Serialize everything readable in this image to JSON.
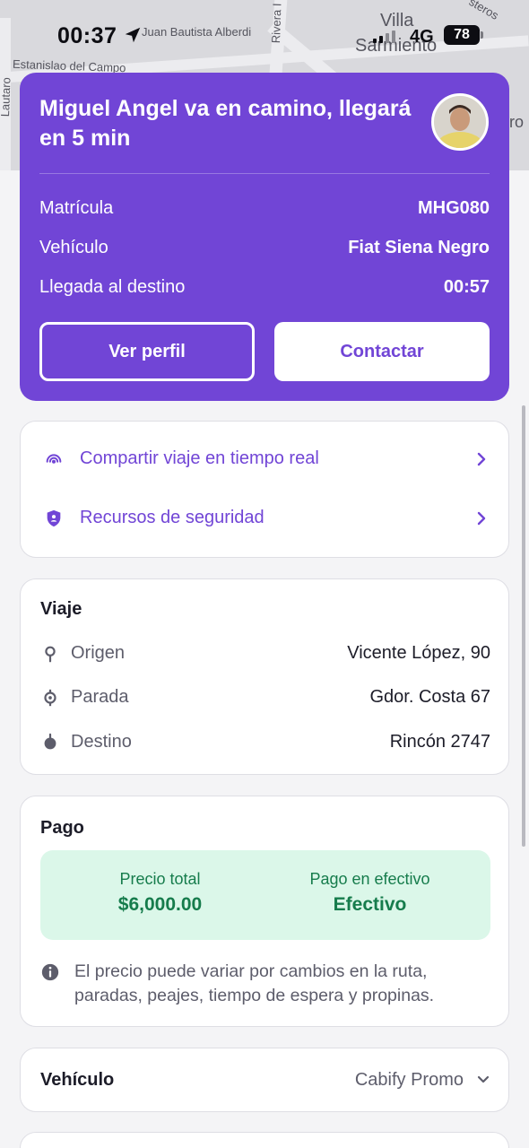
{
  "status_bar": {
    "time": "00:37",
    "network": "4G",
    "battery": "78"
  },
  "map": {
    "labels": [
      "Juan Bautista Alberdi",
      "Rivera I",
      "Villa",
      "Sarmiento",
      "Estanislao del Campo",
      "Lautaro",
      "steros",
      "ro"
    ]
  },
  "driver": {
    "title": "Miguel Angel va en camino, llegará en 5 min",
    "rows": [
      {
        "label": "Matrícula",
        "value": "MHG080"
      },
      {
        "label": "Vehículo",
        "value": "Fiat Siena Negro"
      },
      {
        "label": "Llegada al destino",
        "value": "00:57"
      }
    ],
    "profile_button": "Ver perfil",
    "contact_button": "Contactar"
  },
  "safety": {
    "share": "Compartir viaje en tiempo real",
    "resources": "Recursos de seguridad"
  },
  "trip": {
    "title": "Viaje",
    "rows": [
      {
        "icon": "origin-pin-icon",
        "label": "Origen",
        "value": "Vicente López, 90"
      },
      {
        "icon": "stop-pin-icon",
        "label": "Parada",
        "value": "Gdor. Costa 67"
      },
      {
        "icon": "destination-pin-icon",
        "label": "Destino",
        "value": "Rincón 2747"
      }
    ]
  },
  "payment": {
    "title": "Pago",
    "total_label": "Precio total",
    "total_value": "$6,000.00",
    "method_label": "Pago en efectivo",
    "method_value": "Efectivo",
    "note": "El precio puede variar por cambios en la ruta, paradas, peajes, tiempo de espera y propinas."
  },
  "vehicle": {
    "title": "Vehículo",
    "selected": "Cabify Promo"
  },
  "colors": {
    "accent": "#7145d6",
    "payment_bg": "#dbf7e9",
    "payment_text": "#167c4c"
  }
}
